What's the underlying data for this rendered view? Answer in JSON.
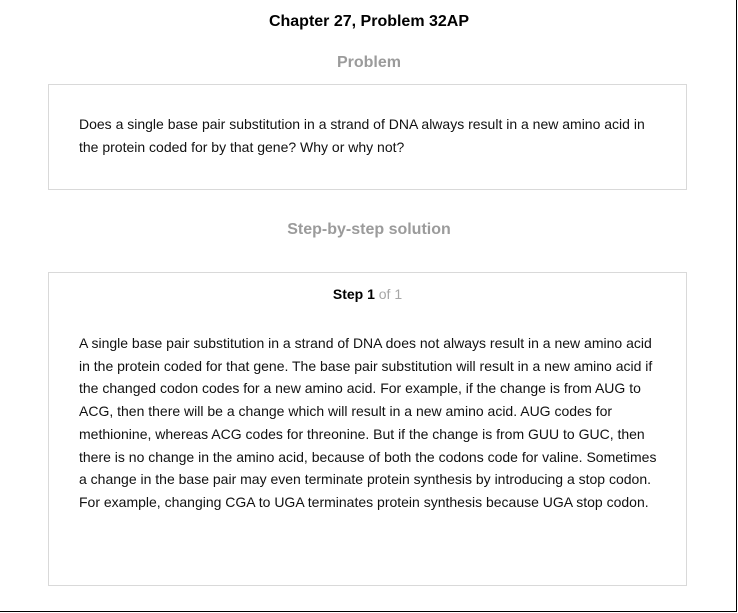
{
  "header": {
    "chapter_title": "Chapter 27, Problem 32AP"
  },
  "problem": {
    "heading": "Problem",
    "text": "Does a single base pair substitution in a strand of DNA always result in a new amino acid in the protein coded for by that gene? Why or why not?"
  },
  "solution": {
    "heading": "Step-by-step solution",
    "step": {
      "label": "Step 1",
      "of_label": "of 1"
    },
    "text": "A single base pair substitution in a strand of DNA does not always result in a new amino acid in the protein coded for that gene. The base pair substitution will result in a new amino acid if the changed codon codes for a new amino acid. For example, if the change is from AUG to ACG, then there will be a change which will result in a new amino acid. AUG codes for methionine, whereas ACG codes for threonine. But if the change is from GUU to GUC, then there is no change in the amino acid, because of both the codons code for valine. Sometimes a change in the base pair may even terminate protein synthesis by introducing a stop codon. For example, changing CGA to UGA terminates protein synthesis because UGA stop codon."
  },
  "colors": {
    "heading_gray": "#9b9b9b",
    "box_border": "#d9d9d9",
    "step_of_gray": "#a6a6a6"
  }
}
